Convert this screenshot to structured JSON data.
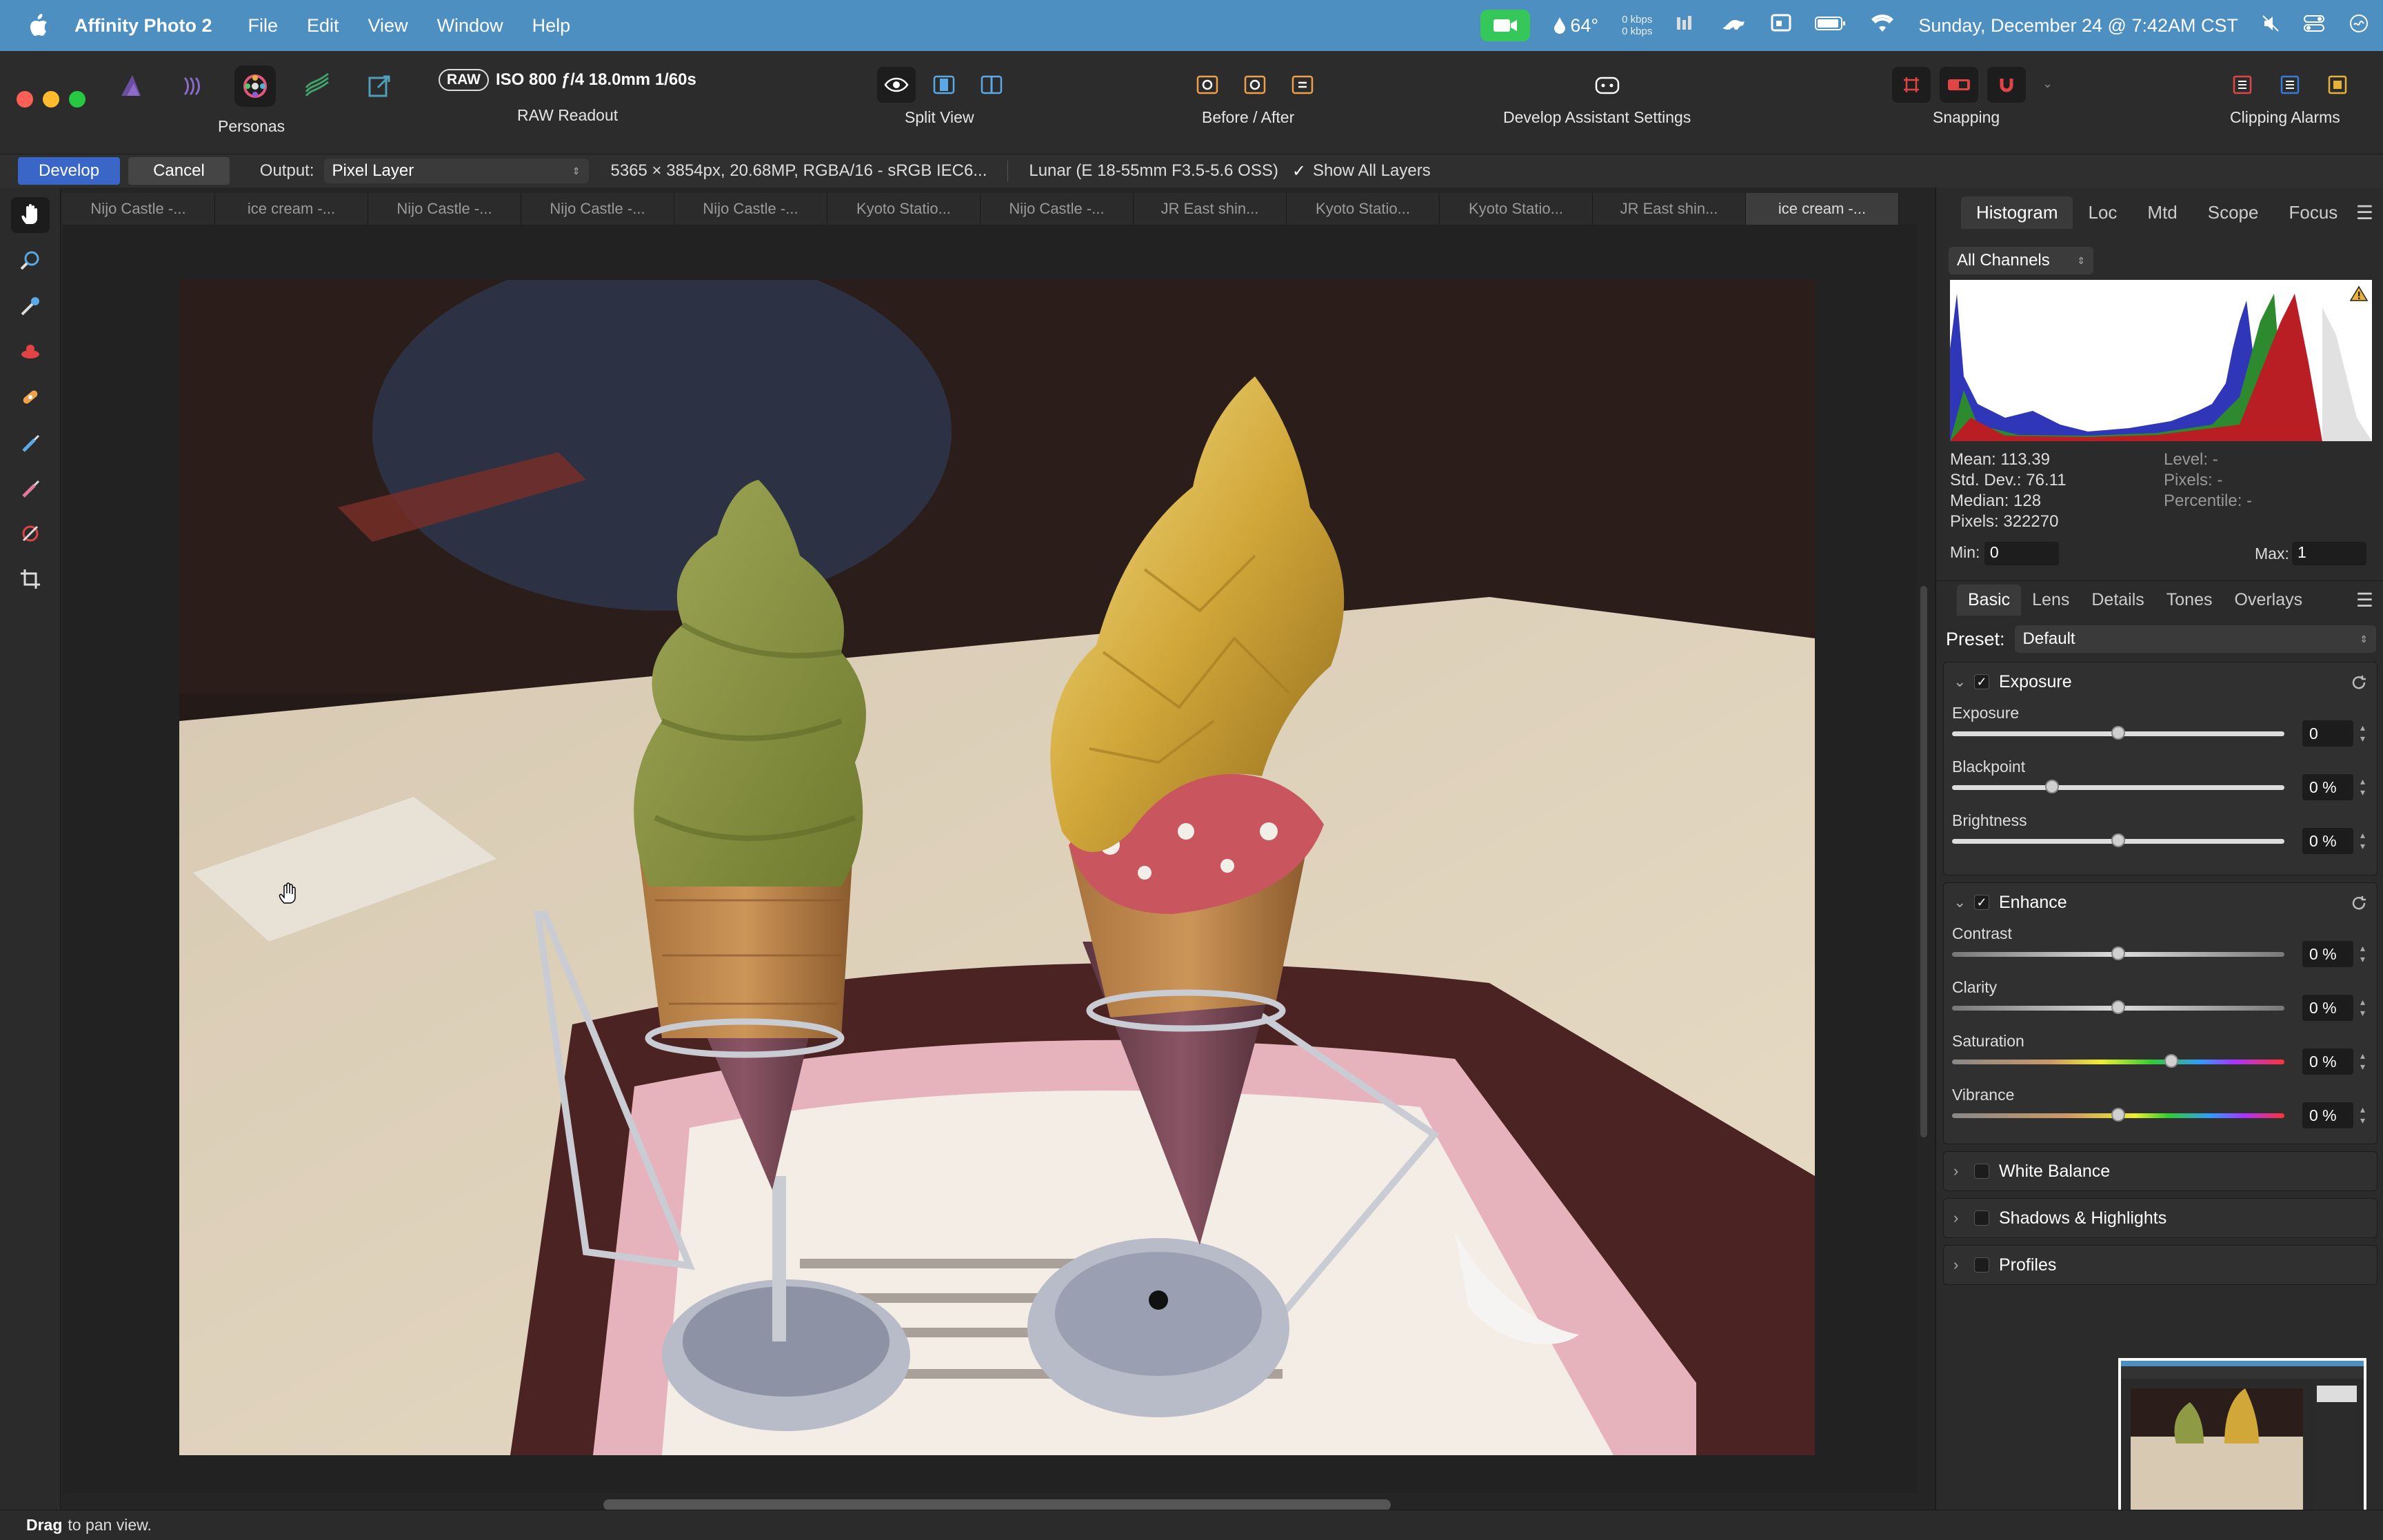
{
  "menubar": {
    "app_name": "Affinity Photo 2",
    "items": [
      "File",
      "Edit",
      "View",
      "Window",
      "Help"
    ],
    "temperature": "64°",
    "net_up": "0 kbps",
    "net_down": "0 kbps",
    "datetime": "Sunday, December 24 @ 7:42AM CST"
  },
  "toolbar": {
    "personas_label": "Personas",
    "raw_tag": "RAW",
    "raw_info": "ISO 800 ƒ/4 18.0mm 1/60s",
    "raw_readout_label": "RAW Readout",
    "split_view_label": "Split View",
    "before_after_label": "Before / After",
    "assistant_label": "Develop Assistant Settings",
    "snapping_label": "Snapping",
    "clipping_label": "Clipping Alarms"
  },
  "context": {
    "develop": "Develop",
    "cancel": "Cancel",
    "output_label": "Output:",
    "output_value": "Pixel Layer",
    "image_info": "5365 × 3854px, 20.68MP, RGBA/16 - sRGB IEC6...",
    "lens_info": "Lunar (E 18-55mm F3.5-5.6 OSS)",
    "show_all_layers": "Show All Layers"
  },
  "tabs": [
    {
      "label": "Nijo Castle -..."
    },
    {
      "label": "ice cream -..."
    },
    {
      "label": "Nijo Castle -..."
    },
    {
      "label": "Nijo Castle -..."
    },
    {
      "label": "Nijo Castle -..."
    },
    {
      "label": "Kyoto Statio..."
    },
    {
      "label": "Nijo Castle -..."
    },
    {
      "label": "JR East shin..."
    },
    {
      "label": "Kyoto Statio..."
    },
    {
      "label": "Kyoto Statio..."
    },
    {
      "label": "JR East shin..."
    },
    {
      "label": "ice cream -..."
    }
  ],
  "active_tab": 11,
  "histogram": {
    "tabs": [
      "Histogram",
      "Loc",
      "Mtd",
      "Scope",
      "Focus"
    ],
    "channel": "All Channels",
    "mean": "Mean: 113.39",
    "std_dev": "Std. Dev.: 76.11",
    "median": "Median: 128",
    "pixels": "Pixels: 322270",
    "level": "Level: -",
    "pixels_sel": "Pixels: -",
    "percentile": "Percentile: -",
    "min_label": "Min:",
    "min_value": "0",
    "max_label": "Max:",
    "max_value": "1"
  },
  "develop_panel": {
    "tabs": [
      "Basic",
      "Lens",
      "Details",
      "Tones",
      "Overlays"
    ],
    "preset_label": "Preset:",
    "preset_value": "Default",
    "exposure": {
      "title": "Exposure",
      "sliders": [
        {
          "label": "Exposure",
          "value": "0",
          "level": 0.5
        },
        {
          "label": "Blackpoint",
          "value": "0 %",
          "level": 0.3
        },
        {
          "label": "Brightness",
          "value": "0 %",
          "level": 0.5
        }
      ]
    },
    "enhance": {
      "title": "Enhance",
      "sliders": [
        {
          "label": "Contrast",
          "value": "0 %",
          "level": 0.5
        },
        {
          "label": "Clarity",
          "value": "0 %",
          "level": 0.5
        },
        {
          "label": "Saturation",
          "value": "0 %",
          "level": 0.66
        },
        {
          "label": "Vibrance",
          "value": "0 %",
          "level": 0.5
        }
      ]
    },
    "collapsed": [
      "White Balance",
      "Shadows & Highlights",
      "Profiles"
    ]
  },
  "status": {
    "bold": "Drag",
    "text": "to pan view."
  }
}
